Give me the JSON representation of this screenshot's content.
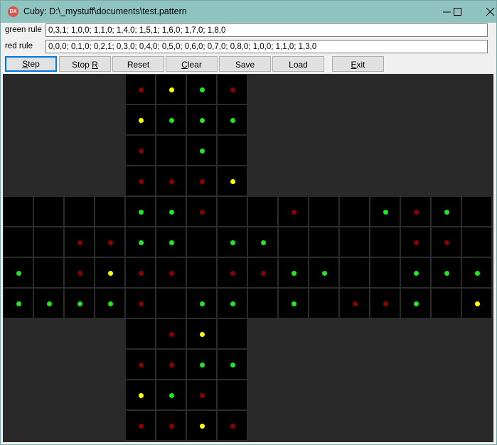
{
  "window": {
    "title": "Cuby: D:\\_mystuff\\documents\\test.pattern",
    "icon_text": "DX"
  },
  "rules": {
    "green_label": "green rule",
    "green_value": "0,3,1; 1,0,0; 1,1,0; 1,4,0; 1,5,1; 1,6,0; 1,7,0; 1,8,0",
    "red_label": "red rule",
    "red_value": "0,0,0; 0,1,0; 0,2,1; 0,3,0; 0,4,0; 0,5,0; 0,6,0; 0,7,0; 0,8,0; 1,0,0; 1,1,0; 1,3,0"
  },
  "toolbar": {
    "step": {
      "pre": "",
      "mn": "S",
      "post": "tep"
    },
    "stop": {
      "pre": "Stop ",
      "mn": "R",
      "post": ""
    },
    "reset": {
      "pre": "Reset",
      "mn": "",
      "post": ""
    },
    "clear": {
      "pre": "",
      "mn": "C",
      "post": "lear"
    },
    "save": {
      "pre": "Save",
      "mn": "",
      "post": ""
    },
    "load": {
      "pre": "Load",
      "mn": "",
      "post": ""
    },
    "exit": {
      "pre": "",
      "mn": "E",
      "post": "xit"
    }
  },
  "colors": {
    "green": "#22e622",
    "red": "#8b0000",
    "yellow": "#ffff00",
    "cell": "#000000"
  },
  "grid": {
    "legend": "r = red, g = green, y = yellow, . = empty, space = no cell",
    "rows": [
      "    rygr    ",
      "    yggg    ",
      "    r.g.    ",
      "    rrry    ",
      "....ggr..r..grg.",
      "..rrgg.gg....rr.",
      "g.ryrr.rrgg..ggg",
      "ggggr.gg.g.rrg.y",
      "    .ry.    ",
      "    rrgg    ",
      "    ygr.    ",
      "    rryr    "
    ]
  }
}
